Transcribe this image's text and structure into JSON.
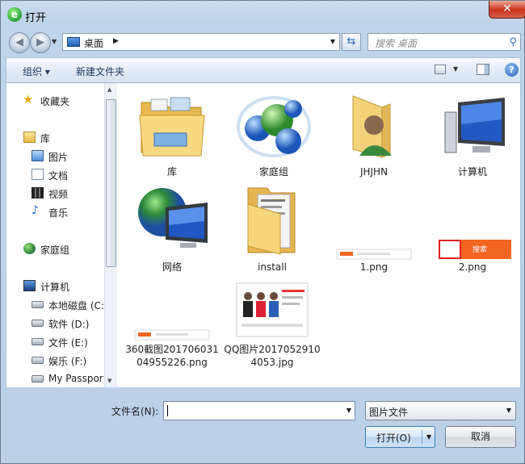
{
  "window": {
    "title": "打开",
    "close_glyph": "✕"
  },
  "address_bar": {
    "location": "桌面",
    "separator": "▶"
  },
  "search": {
    "placeholder": "搜索 桌面"
  },
  "toolbar": {
    "organize": "组织 ▾",
    "new_folder": "新建文件夹"
  },
  "nav_pane": {
    "items": [
      {
        "label": "收藏夹",
        "icon": "star-icon"
      },
      {
        "label": "库",
        "icon": "library-icon"
      },
      {
        "label": "图片",
        "icon": "pictures-icon"
      },
      {
        "label": "文档",
        "icon": "documents-icon"
      },
      {
        "label": "视频",
        "icon": "videos-icon"
      },
      {
        "label": "音乐",
        "icon": "music-icon"
      },
      {
        "label": "家庭组",
        "icon": "homegroup-icon"
      },
      {
        "label": "计算机",
        "icon": "computer-icon"
      },
      {
        "label": "本地磁盘 (C:",
        "icon": "drive-icon"
      },
      {
        "label": "软件 (D:)",
        "icon": "drive-icon"
      },
      {
        "label": "文件 (E:)",
        "icon": "drive-icon"
      },
      {
        "label": "娱乐 (F:)",
        "icon": "drive-icon"
      },
      {
        "label": "My Passpor",
        "icon": "drive-icon"
      }
    ]
  },
  "files": [
    {
      "name": "库",
      "icon": "library-folder-icon"
    },
    {
      "name": "家庭组",
      "icon": "homegroup-icon"
    },
    {
      "name": "JHJHN",
      "icon": "user-folder-icon"
    },
    {
      "name": "计算机",
      "icon": "computer-icon"
    },
    {
      "name": "网络",
      "icon": "network-icon"
    },
    {
      "name": "install",
      "icon": "folder-icon"
    },
    {
      "name": "1.png",
      "icon": "image-thumbnail"
    },
    {
      "name": "2.png",
      "icon": "image-thumbnail",
      "thumb_button_text": "搜索"
    },
    {
      "name": "360截图20170603104955226.png",
      "icon": "image-thumbnail"
    },
    {
      "name": "QQ图片20170529104053.jpg",
      "icon": "image-thumbnail"
    }
  ],
  "bottom": {
    "filename_label": "文件名(N):",
    "filename_value": "",
    "file_type": "图片文件",
    "open_button": "打开(O)",
    "cancel_button": "取消"
  },
  "colors": {
    "accent_orange": "#f26522",
    "highlight_red": "#e02020",
    "title_green": "#3cb54a"
  }
}
